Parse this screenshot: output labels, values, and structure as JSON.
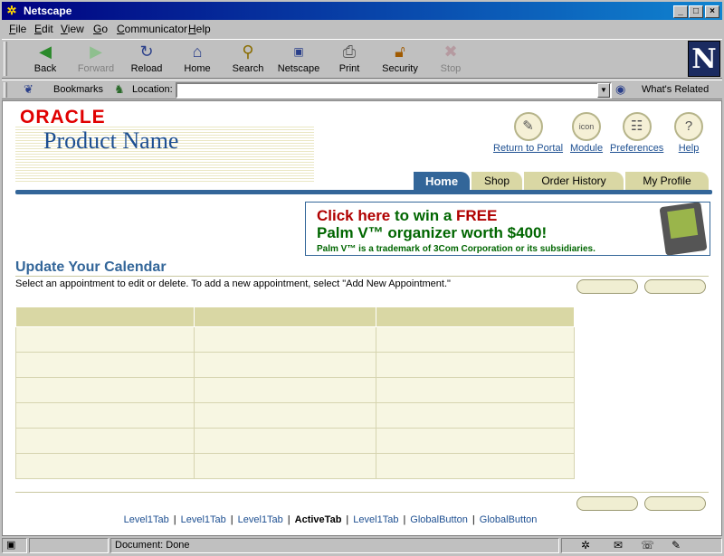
{
  "window": {
    "title": "Netscape"
  },
  "menu": [
    "File",
    "Edit",
    "View",
    "Go",
    "Communicator",
    "Help"
  ],
  "toolbar": {
    "buttons": [
      {
        "label": "Back",
        "icon": "back-arrow-icon"
      },
      {
        "label": "Forward",
        "icon": "forward-arrow-icon"
      },
      {
        "label": "Reload",
        "icon": "reload-icon"
      },
      {
        "label": "Home",
        "icon": "home-icon"
      },
      {
        "label": "Search",
        "icon": "search-icon"
      },
      {
        "label": "Netscape",
        "icon": "netscape-icon"
      },
      {
        "label": "Print",
        "icon": "print-icon"
      },
      {
        "label": "Security",
        "icon": "lock-icon"
      },
      {
        "label": "Stop",
        "icon": "stop-icon"
      }
    ]
  },
  "location_bar": {
    "bookmarks": "Bookmarks",
    "location_label": "Location:",
    "value": "",
    "whats_related": "What's Related"
  },
  "page": {
    "brand": "ORACLE",
    "product": "Product Name",
    "global_buttons": [
      "Return to Portal",
      "Module",
      "Preferences",
      "Help"
    ],
    "tabs": [
      "Home",
      "Shop",
      "Order History",
      "My Profile"
    ],
    "banner": {
      "click_here": "Click here",
      "to_win": "to win a",
      "free": "FREE",
      "line2": "Palm V™ organizer worth $400!",
      "line3": "Palm V™ is a trademark of 3Com Corporation or its subsidiaries."
    },
    "title": "Update Your Calendar",
    "instructions": "Select an appointment to edit or delete. To add a new appointment, select \"Add New Appointment.\"",
    "footer_links": [
      "Level1Tab",
      "Level1Tab",
      "Level1Tab",
      "ActiveTab",
      "Level1Tab",
      "GlobalButton",
      "GlobalButton"
    ]
  },
  "status": {
    "text": "Document: Done"
  },
  "colors": {
    "accent": "#336699",
    "tab": "#d9d7a4",
    "brand_red": "#e00000"
  }
}
